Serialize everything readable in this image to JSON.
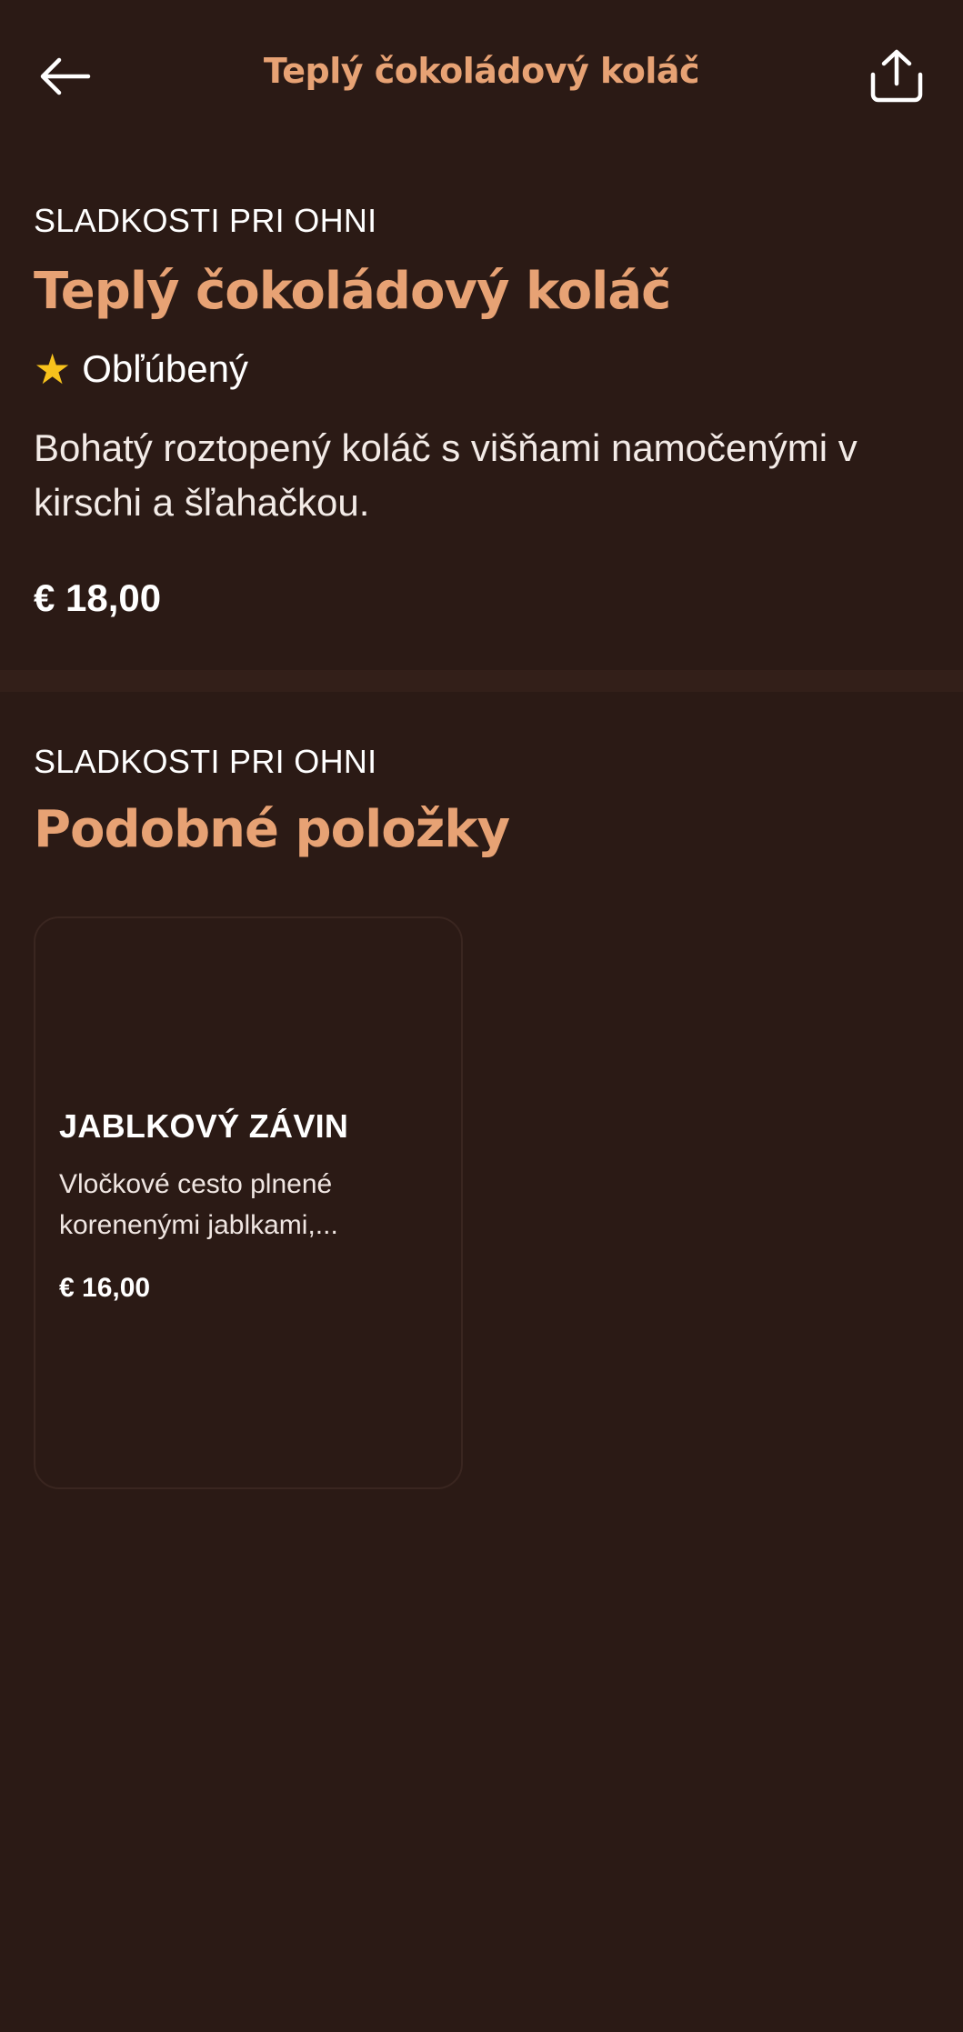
{
  "header": {
    "title": "Teplý čokoládový koláč",
    "back_icon": "arrow-left-icon",
    "share_icon": "share-icon"
  },
  "item": {
    "category": "SLADKOSTI PRI OHNI",
    "name": "Teplý čokoládový koláč",
    "badge_icon": "star-icon",
    "badge_label": "Obľúbený",
    "description": "Bohatý roztopený koláč s višňami namočenými v kirschi a šľahačkou.",
    "price": "€ 18,00"
  },
  "similar": {
    "category": "SLADKOSTI PRI OHNI",
    "title": "Podobné položky",
    "items": [
      {
        "name": "JABLKOVÝ ZÁVIN",
        "description": "Vločkové cesto plnené korenenými jablkami,...",
        "price": "€ 16,00"
      }
    ]
  },
  "colors": {
    "background": "#2b1a15",
    "accent": "#e7a274",
    "star": "#f7c21c",
    "divider": "#331f19"
  }
}
